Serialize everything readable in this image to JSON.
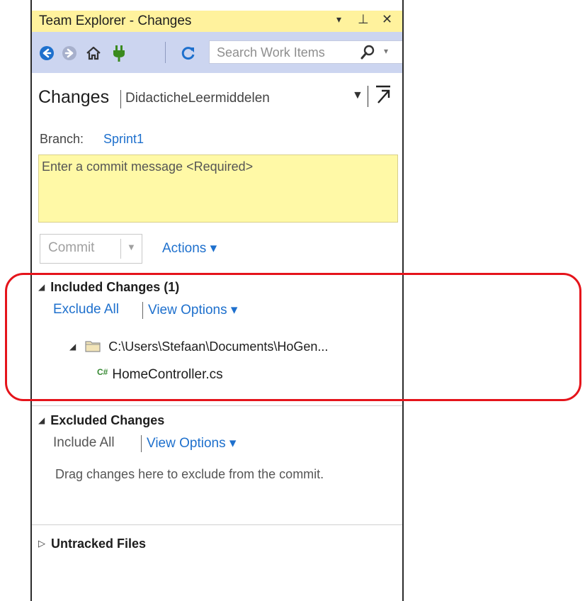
{
  "window": {
    "title": "Team Explorer - Changes",
    "controls": [
      "▾",
      "⊥",
      "✕"
    ]
  },
  "toolbar": {
    "search_placeholder": "Search Work Items"
  },
  "header": {
    "title": "Changes",
    "subtitle": "DidacticheLeermiddelen"
  },
  "branch": {
    "label": "Branch:",
    "name": "Sprint1"
  },
  "commit": {
    "placeholder": "Enter a commit message <Required>",
    "button_label": "Commit",
    "actions_label": "Actions ▾"
  },
  "included": {
    "title": "Included Changes (1)",
    "exclude_all": "Exclude All",
    "view_options": "View Options ▾",
    "folder_path": "C:\\Users\\Stefaan\\Documents\\HoGen...",
    "file_badge": "C#",
    "file_name": "HomeController.cs"
  },
  "excluded": {
    "title": "Excluded Changes",
    "include_all": "Include All",
    "view_options": "View Options ▾",
    "hint": "Drag changes here to exclude from the commit."
  },
  "untracked": {
    "title": "Untracked Files"
  },
  "colors": {
    "title_bar": "#fff29d",
    "toolbar": "#ccd5f0",
    "link": "#1e70cd",
    "commit_box": "#fff9a6",
    "highlight": "#e5141b"
  }
}
